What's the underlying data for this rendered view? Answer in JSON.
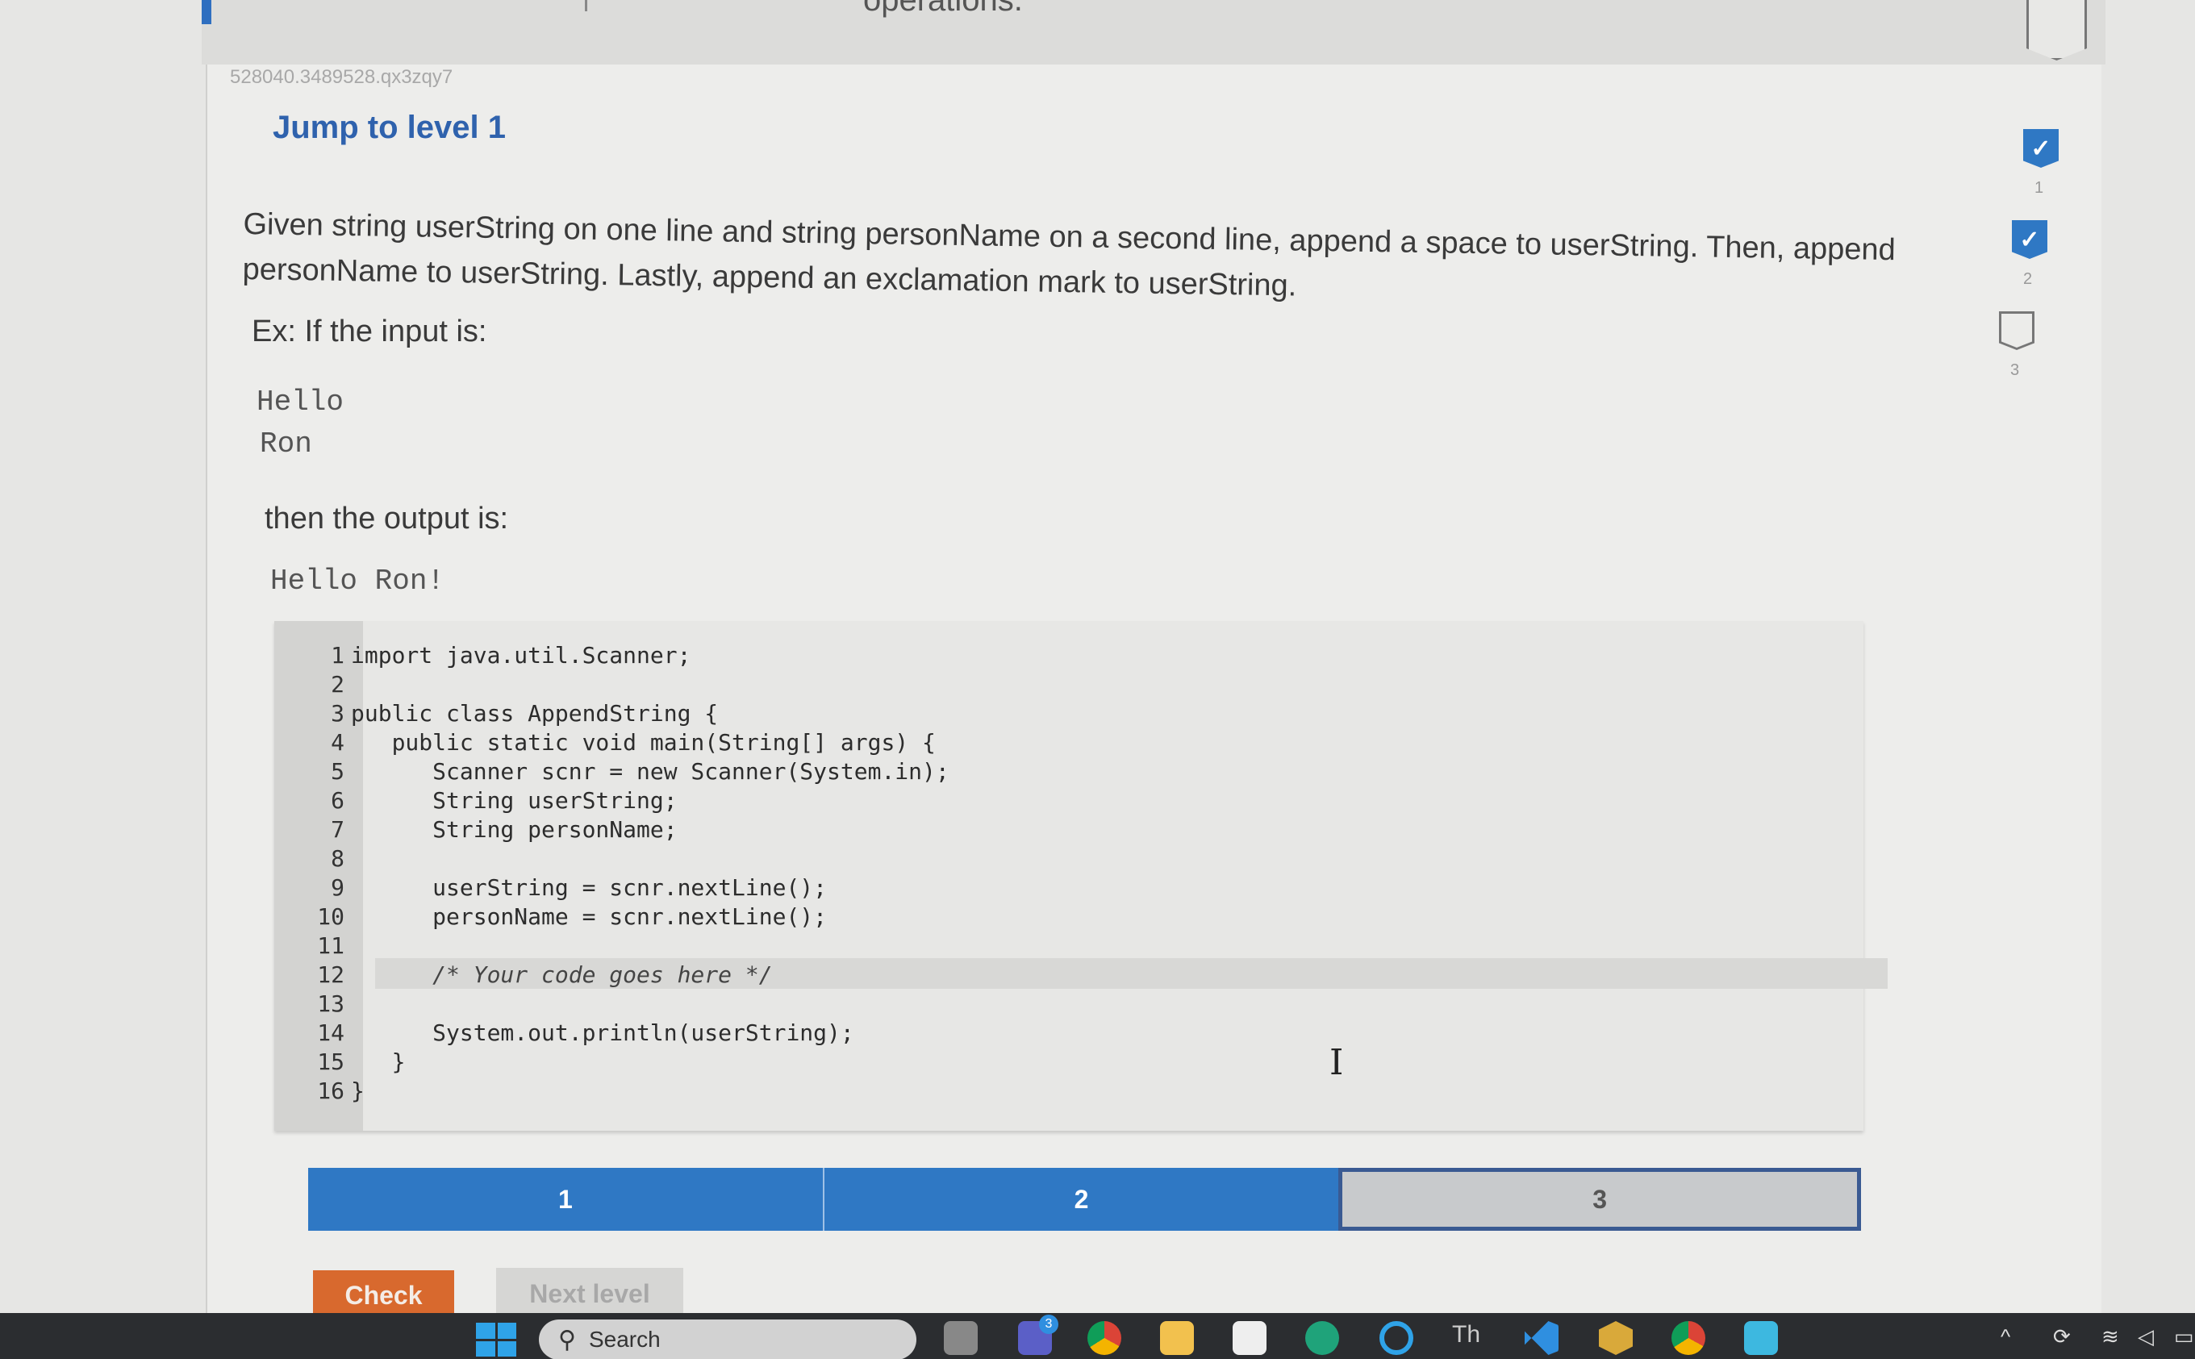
{
  "top_strip": {
    "fragment_text": "operations."
  },
  "activity": {
    "id": "528040.3489528.qx3zqy7",
    "jump_title": "Jump to level 1",
    "prompt": "Given string userString on one line and string personName on a second line, append a space to userString. Then, append personName to userString. Lastly, append an exclamation mark to userString.",
    "example_label": "Ex: If the input is:",
    "example_input": [
      "Hello",
      "Ron"
    ],
    "output_label": "then the output is:",
    "example_output": "Hello Ron!"
  },
  "editor": {
    "lines": [
      {
        "n": "1",
        "code": "import java.util.Scanner;"
      },
      {
        "n": "2",
        "code": ""
      },
      {
        "n": "3",
        "code": "public class AppendString {"
      },
      {
        "n": "4",
        "code": "   public static void main(String[] args) {"
      },
      {
        "n": "5",
        "code": "      Scanner scnr = new Scanner(System.in);"
      },
      {
        "n": "6",
        "code": "      String userString;"
      },
      {
        "n": "7",
        "code": "      String personName;"
      },
      {
        "n": "8",
        "code": ""
      },
      {
        "n": "9",
        "code": "      userString = scnr.nextLine();"
      },
      {
        "n": "10",
        "code": "      personName = scnr.nextLine();"
      },
      {
        "n": "11",
        "code": ""
      },
      {
        "n": "12",
        "code": "      /* Your code goes here */"
      },
      {
        "n": "13",
        "code": ""
      },
      {
        "n": "14",
        "code": "      System.out.println(userString);"
      },
      {
        "n": "15",
        "code": "   }"
      },
      {
        "n": "16",
        "code": "}"
      }
    ]
  },
  "levels": [
    {
      "label": "1",
      "state": "completed"
    },
    {
      "label": "2",
      "state": "completed"
    },
    {
      "label": "3",
      "state": "current"
    }
  ],
  "level_indicators": [
    {
      "label": "1",
      "state": "completed",
      "icon": "check-icon"
    },
    {
      "label": "2",
      "state": "completed",
      "icon": "check-icon"
    },
    {
      "label": "3",
      "state": "incomplete",
      "icon": "empty-shield-icon"
    }
  ],
  "buttons": {
    "check": "Check",
    "next_level": "Next level"
  },
  "colors": {
    "accent_blue": "#2f78c4",
    "check_orange": "#d8692e",
    "title_blue": "#2f62ad"
  },
  "taskbar": {
    "search_placeholder": "Search",
    "teams_badge": "3",
    "apps": [
      "start",
      "task-view",
      "teams",
      "chrome",
      "file-explorer",
      "microsoft-store",
      "edge",
      "cortana",
      "thonny",
      "vscode",
      "netbeans",
      "chrome-profile",
      "notepad"
    ],
    "tray": [
      "chevron-up-icon",
      "sync-icon",
      "wifi-icon",
      "volume-icon",
      "battery-icon"
    ]
  }
}
